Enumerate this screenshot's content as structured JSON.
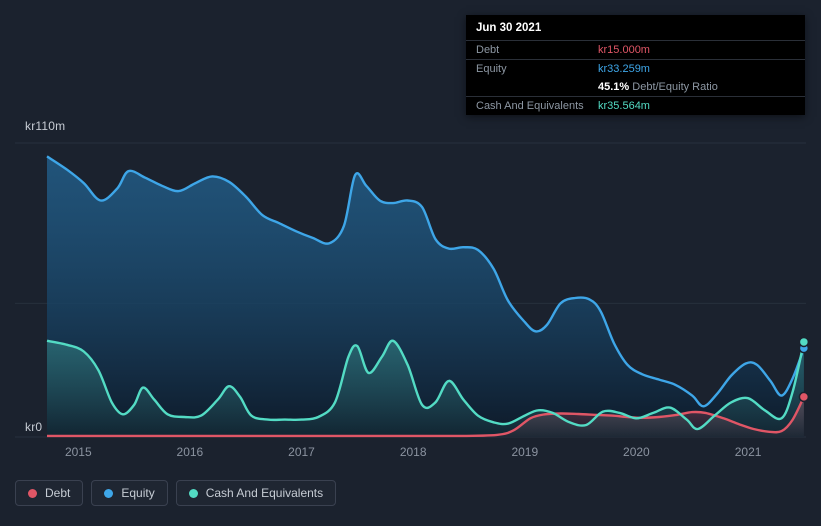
{
  "colors": {
    "debt": "#e05666",
    "equity": "#3ea6e8",
    "cash": "#53dbc4",
    "background": "#1b222e",
    "grid": "#27303d",
    "tooltip_bg": "#000000"
  },
  "y_axis": {
    "top_label": "kr110m",
    "bottom_label": "kr0"
  },
  "x_axis": {
    "ticks": [
      "2015",
      "2016",
      "2017",
      "2018",
      "2019",
      "2020",
      "2021"
    ]
  },
  "tooltip": {
    "date": "Jun 30 2021",
    "debt": {
      "label": "Debt",
      "value": "kr15.000m"
    },
    "equity": {
      "label": "Equity",
      "value": "kr33.259m"
    },
    "ratio": {
      "value": "45.1%",
      "label": "Debt/Equity Ratio"
    },
    "cash": {
      "label": "Cash And Equivalents",
      "value": "kr35.564m"
    }
  },
  "legend": {
    "items": [
      {
        "label": "Debt"
      },
      {
        "label": "Equity"
      },
      {
        "label": "Cash And Equivalents"
      }
    ]
  },
  "chart_data": {
    "type": "area",
    "title": "Debt, Equity and Cash And Equivalents history",
    "x_unit": "year",
    "x_range": [
      2014.72,
      2021.51
    ],
    "ylim": [
      0,
      110
    ],
    "y_unit": "kr millions",
    "y_gridlines": [
      110,
      50,
      0
    ],
    "legend_position": "bottom-left",
    "latest": {
      "date": "Jun 30 2021",
      "debt_m": 15.0,
      "equity_m": 33.259,
      "cash_and_equivalents_m": 35.564,
      "debt_equity_ratio_pct": 45.1
    },
    "series": [
      {
        "name": "Debt",
        "color": "#e05666",
        "points": [
          [
            2014.72,
            0.4
          ],
          [
            2015.5,
            0.4
          ],
          [
            2016.5,
            0.4
          ],
          [
            2017.5,
            0.4
          ],
          [
            2018.4,
            0.4
          ],
          [
            2018.75,
            0.8
          ],
          [
            2018.9,
            2.5
          ],
          [
            2019.05,
            7
          ],
          [
            2019.18,
            8.5
          ],
          [
            2019.32,
            8.8
          ],
          [
            2019.48,
            8.6
          ],
          [
            2019.62,
            8.3
          ],
          [
            2019.78,
            8
          ],
          [
            2019.92,
            7.5
          ],
          [
            2020.05,
            7.2
          ],
          [
            2020.2,
            7.5
          ],
          [
            2020.35,
            8.2
          ],
          [
            2020.5,
            9.3
          ],
          [
            2020.62,
            9
          ],
          [
            2020.78,
            7
          ],
          [
            2020.92,
            4.8
          ],
          [
            2021.05,
            3
          ],
          [
            2021.18,
            2
          ],
          [
            2021.3,
            2.2
          ],
          [
            2021.4,
            6.5
          ],
          [
            2021.5,
            15
          ]
        ]
      },
      {
        "name": "Equity",
        "color": "#3ea6e8",
        "points": [
          [
            2014.72,
            105
          ],
          [
            2014.9,
            100
          ],
          [
            2015.05,
            95
          ],
          [
            2015.2,
            88.5
          ],
          [
            2015.35,
            93
          ],
          [
            2015.45,
            99.5
          ],
          [
            2015.6,
            97
          ],
          [
            2015.75,
            94
          ],
          [
            2015.9,
            92
          ],
          [
            2016.05,
            95
          ],
          [
            2016.2,
            97.5
          ],
          [
            2016.35,
            95.5
          ],
          [
            2016.5,
            90
          ],
          [
            2016.65,
            83
          ],
          [
            2016.8,
            80
          ],
          [
            2016.95,
            77
          ],
          [
            2017.1,
            74.5
          ],
          [
            2017.25,
            72.5
          ],
          [
            2017.38,
            79
          ],
          [
            2017.48,
            98
          ],
          [
            2017.58,
            94
          ],
          [
            2017.7,
            88.5
          ],
          [
            2017.82,
            87.5
          ],
          [
            2017.95,
            88.5
          ],
          [
            2018.08,
            86
          ],
          [
            2018.2,
            74
          ],
          [
            2018.32,
            70.5
          ],
          [
            2018.45,
            71
          ],
          [
            2018.58,
            70
          ],
          [
            2018.72,
            63
          ],
          [
            2018.85,
            51
          ],
          [
            2019.0,
            43
          ],
          [
            2019.1,
            39.5
          ],
          [
            2019.2,
            42
          ],
          [
            2019.32,
            50
          ],
          [
            2019.45,
            52
          ],
          [
            2019.58,
            51.5
          ],
          [
            2019.68,
            47
          ],
          [
            2019.8,
            35
          ],
          [
            2019.92,
            27
          ],
          [
            2020.05,
            23.5
          ],
          [
            2020.2,
            21.5
          ],
          [
            2020.35,
            19.5
          ],
          [
            2020.5,
            15.5
          ],
          [
            2020.6,
            11.5
          ],
          [
            2020.72,
            16
          ],
          [
            2020.85,
            23
          ],
          [
            2020.98,
            27.5
          ],
          [
            2021.08,
            27
          ],
          [
            2021.2,
            21
          ],
          [
            2021.3,
            15.5
          ],
          [
            2021.4,
            22
          ],
          [
            2021.5,
            33.259
          ]
        ]
      },
      {
        "name": "Cash And Equivalents",
        "color": "#53dbc4",
        "points": [
          [
            2014.72,
            36
          ],
          [
            2014.9,
            34.5
          ],
          [
            2015.05,
            32
          ],
          [
            2015.18,
            25
          ],
          [
            2015.3,
            13
          ],
          [
            2015.4,
            8.5
          ],
          [
            2015.5,
            12
          ],
          [
            2015.58,
            18.5
          ],
          [
            2015.68,
            14
          ],
          [
            2015.8,
            8.5
          ],
          [
            2015.95,
            7.5
          ],
          [
            2016.1,
            8
          ],
          [
            2016.25,
            14
          ],
          [
            2016.35,
            19
          ],
          [
            2016.45,
            15
          ],
          [
            2016.55,
            8
          ],
          [
            2016.7,
            6.5
          ],
          [
            2016.85,
            6.5
          ],
          [
            2017.0,
            6.5
          ],
          [
            2017.15,
            7.5
          ],
          [
            2017.3,
            13
          ],
          [
            2017.42,
            30
          ],
          [
            2017.5,
            34
          ],
          [
            2017.6,
            24
          ],
          [
            2017.72,
            30
          ],
          [
            2017.82,
            36
          ],
          [
            2017.95,
            27
          ],
          [
            2018.08,
            12
          ],
          [
            2018.2,
            13
          ],
          [
            2018.32,
            21
          ],
          [
            2018.45,
            14
          ],
          [
            2018.58,
            8
          ],
          [
            2018.72,
            5.5
          ],
          [
            2018.85,
            5
          ],
          [
            2019.0,
            8
          ],
          [
            2019.12,
            10
          ],
          [
            2019.25,
            9
          ],
          [
            2019.4,
            5.5
          ],
          [
            2019.55,
            4.5
          ],
          [
            2019.7,
            9.5
          ],
          [
            2019.85,
            9
          ],
          [
            2020.0,
            7
          ],
          [
            2020.15,
            9
          ],
          [
            2020.3,
            11
          ],
          [
            2020.45,
            6.5
          ],
          [
            2020.55,
            3
          ],
          [
            2020.7,
            8
          ],
          [
            2020.85,
            13
          ],
          [
            2021.0,
            14.5
          ],
          [
            2021.15,
            10
          ],
          [
            2021.3,
            7
          ],
          [
            2021.4,
            17
          ],
          [
            2021.5,
            35.564
          ]
        ]
      }
    ]
  }
}
